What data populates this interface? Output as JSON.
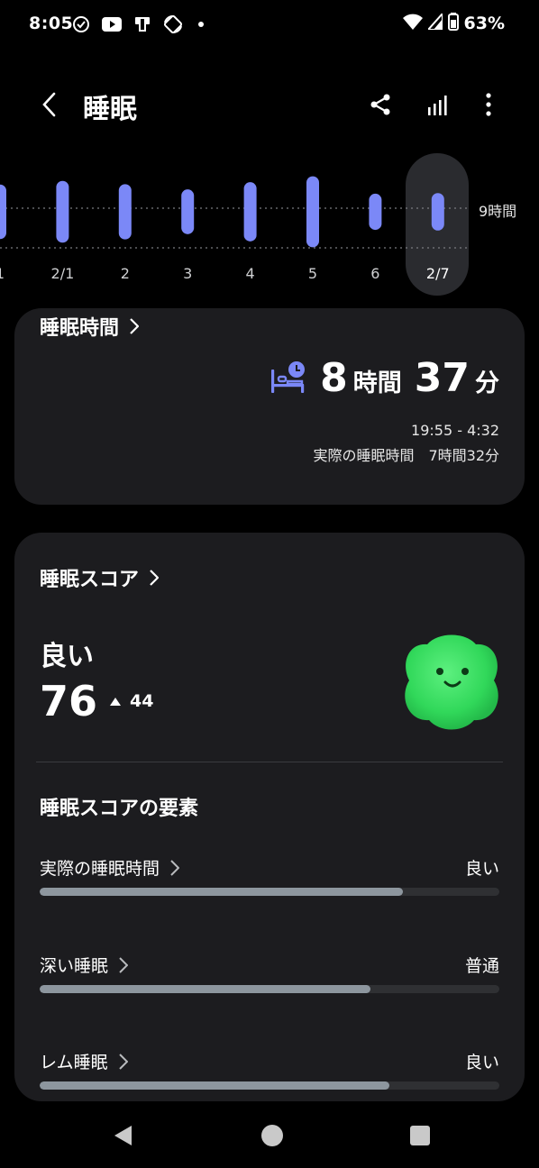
{
  "status_bar": {
    "time": "8:05",
    "battery": "63%",
    "icons": [
      "check-circle-icon",
      "youtube-icon",
      "device-icon",
      "rotate-icon",
      "dot-icon",
      "wifi-icon",
      "signal-icon",
      "battery-icon"
    ]
  },
  "app_bar": {
    "title": "睡眠",
    "actions": [
      "share-icon",
      "bar-chart-icon",
      "more-vert-icon"
    ]
  },
  "chart_data": {
    "type": "bar",
    "categories": [
      "1",
      "2/1",
      "2",
      "3",
      "4",
      "5",
      "6",
      "2/7"
    ],
    "reference_label": "9時間",
    "selected": "2/7",
    "bar_color": "#7b88f7",
    "reference_line_hours": 9,
    "values": [
      8.3,
      9.4,
      8.4,
      6.8,
      9.0,
      10.8,
      5.5,
      5.7
    ]
  },
  "duration_card": {
    "header": "睡眠時間",
    "hours": "8",
    "hours_unit": "時間",
    "minutes": "37",
    "minutes_unit": "分",
    "time_range": "19:55 - 4:32",
    "actual_label": "実際の睡眠時間",
    "actual_value": "7時間32分"
  },
  "score_card": {
    "header": "睡眠スコア",
    "rating": "良い",
    "score": "76",
    "change": "44",
    "factors_title": "睡眠スコアの要素",
    "factors": [
      {
        "name": "実際の睡眠時間",
        "value": "良い",
        "level": 0.79
      },
      {
        "name": "深い睡眠",
        "value": "普通",
        "level": 0.72
      },
      {
        "name": "レム睡眠",
        "value": "良い",
        "level": 0.76
      }
    ]
  },
  "colors": {
    "accent": "#7b88f7",
    "card_bg": "#1c1c1f",
    "bar_fill": "#8d969e",
    "mascot": "#3fe06a"
  }
}
